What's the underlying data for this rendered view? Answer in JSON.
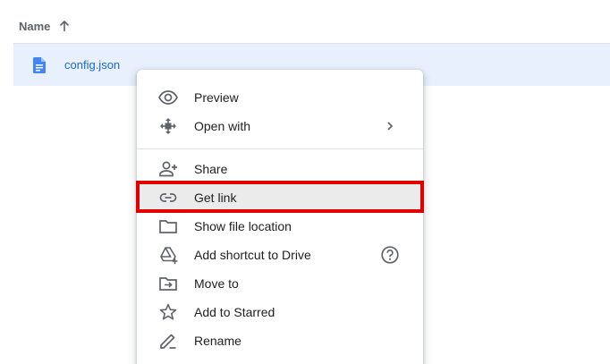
{
  "list": {
    "header": {
      "name_label": "Name",
      "sort_icon": "arrow-up-icon"
    },
    "selected_file": {
      "name": "config.json",
      "icon": "document-icon"
    }
  },
  "context_menu": {
    "items": [
      {
        "label": "Preview",
        "icon": "eye-icon"
      },
      {
        "label": "Open with",
        "icon": "move-arrows-icon",
        "trailing": "chevron-right-icon"
      },
      {
        "label": "Share",
        "icon": "person-add-icon"
      },
      {
        "label": "Get link",
        "icon": "link-icon",
        "highlighted": true
      },
      {
        "label": "Show file location",
        "icon": "folder-icon"
      },
      {
        "label": "Add shortcut to Drive",
        "icon": "drive-shortcut-icon",
        "trailing": "help-circle-icon"
      },
      {
        "label": "Move to",
        "icon": "move-to-folder-icon"
      },
      {
        "label": "Add to Starred",
        "icon": "star-outline-icon"
      },
      {
        "label": "Rename",
        "icon": "pencil-icon"
      }
    ]
  },
  "colors": {
    "selection_bg": "#e8f0fe",
    "file_name": "#1967d2",
    "doc_icon": "#4285f4",
    "highlight_box": "#e00000",
    "icon_gray": "#5f6368"
  }
}
